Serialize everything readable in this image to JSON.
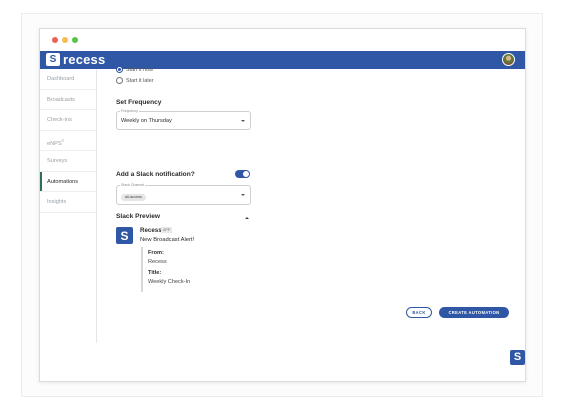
{
  "app": {
    "name": "recess",
    "logo_glyph": "S"
  },
  "colors": {
    "brand": "#2f57a6",
    "active_nav": "#2f6e55"
  },
  "sidebar": {
    "items": [
      {
        "label": "Dashboard",
        "active": false
      },
      {
        "label": "Broadcasts",
        "active": false
      },
      {
        "label": "Check-ins",
        "active": false
      },
      {
        "label": "eNPS",
        "active": false
      },
      {
        "label": "Surveys",
        "active": false
      },
      {
        "label": "Automations",
        "active": true
      },
      {
        "label": "Insights",
        "active": false
      }
    ],
    "enps_superscript": "®"
  },
  "start": {
    "options": [
      {
        "label": "Start it now",
        "checked": true
      },
      {
        "label": "Start it later",
        "checked": false
      }
    ]
  },
  "frequency": {
    "heading": "Set Frequency",
    "field_label": "Frequency",
    "value": "Weekly on Thursday"
  },
  "slack": {
    "heading": "Add a Slack notification?",
    "toggle_on": true,
    "channel_label": "Slack Channel",
    "channel_chip": "all-access"
  },
  "preview": {
    "heading": "Slack Preview",
    "bot_name": "Recess",
    "bot_badge": "APP",
    "bot_glyph": "S",
    "message": "New Broadcast Alert!",
    "from_label": "From:",
    "from_value": "Recess",
    "title_label": "Title:",
    "title_value": "Weekly Check-In"
  },
  "actions": {
    "back": "BACK",
    "create": "CREATE AUTOMATION"
  },
  "corner_widget_glyph": "S"
}
